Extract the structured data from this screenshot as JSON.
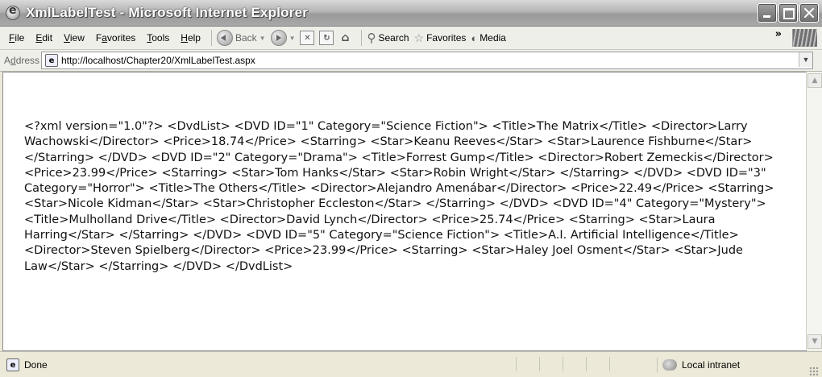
{
  "window": {
    "title": "XmlLabelTest - Microsoft Internet Explorer"
  },
  "menu": {
    "items": [
      {
        "accel": "F",
        "rest": "ile"
      },
      {
        "accel": "E",
        "rest": "dit"
      },
      {
        "accel": "V",
        "rest": "iew"
      },
      {
        "pre": "F",
        "accel": "a",
        "rest": "vorites"
      },
      {
        "accel": "T",
        "rest": "ools"
      },
      {
        "accel": "H",
        "rest": "elp"
      }
    ]
  },
  "toolbar": {
    "back_label": "Back",
    "search_label": "Search",
    "favorites_label": "Favorites",
    "media_label": "Media",
    "overflow": "»"
  },
  "address": {
    "label_accel": "d",
    "label_pre": "A",
    "label_rest": "dress",
    "url": "http://localhost/Chapter20/XmlLabelTest.aspx"
  },
  "content": {
    "xml": "<?xml version=\"1.0\"?> <DvdList> <DVD ID=\"1\" Category=\"Science Fiction\"> <Title>The Matrix</Title> <Director>Larry Wachowski</Director> <Price>18.74</Price> <Starring> <Star>Keanu Reeves</Star> <Star>Laurence Fishburne</Star> </Starring> </DVD> <DVD ID=\"2\" Category=\"Drama\"> <Title>Forrest Gump</Title> <Director>Robert Zemeckis</Director> <Price>23.99</Price> <Starring> <Star>Tom Hanks</Star> <Star>Robin Wright</Star> </Starring> </DVD> <DVD ID=\"3\" Category=\"Horror\"> <Title>The Others</Title> <Director>Alejandro Amenábar</Director> <Price>22.49</Price> <Starring> <Star>Nicole Kidman</Star> <Star>Christopher Eccleston</Star> </Starring> </DVD> <DVD ID=\"4\" Category=\"Mystery\"> <Title>Mulholland Drive</Title> <Director>David Lynch</Director> <Price>25.74</Price> <Starring> <Star>Laura Harring</Star> </Starring> </DVD> <DVD ID=\"5\" Category=\"Science Fiction\"> <Title>A.I. Artificial Intelligence</Title> <Director>Steven Spielberg</Director> <Price>23.99</Price> <Starring> <Star>Haley Joel Osment</Star> <Star>Jude Law</Star> </Starring> </DVD> </DvdList>"
  },
  "status": {
    "text": "Done",
    "zone": "Local intranet"
  },
  "icons": [
    "ie-icon",
    "minimize-icon",
    "maximize-icon",
    "close-icon",
    "back-icon",
    "forward-icon",
    "stop-icon",
    "refresh-icon",
    "home-icon",
    "search-icon",
    "favorites-star-icon",
    "media-icon",
    "windows-logo-icon",
    "page-icon",
    "intranet-zone-icon"
  ]
}
